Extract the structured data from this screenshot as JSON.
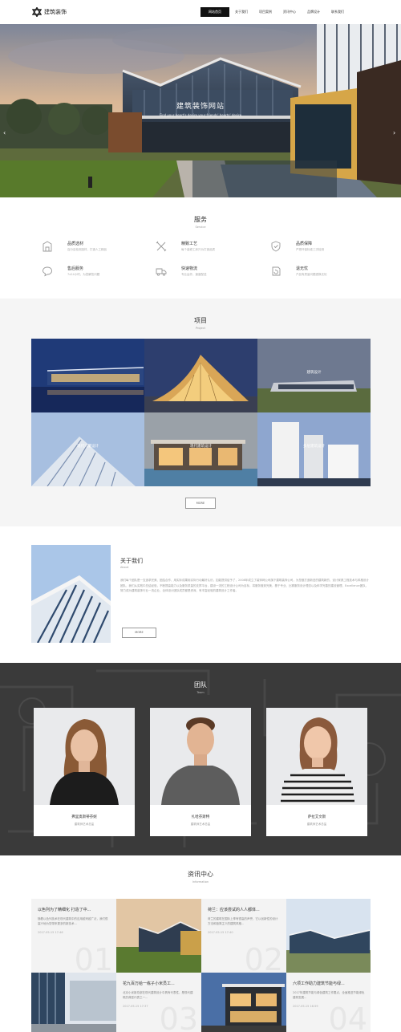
{
  "header": {
    "logo_text": "建筑装饰",
    "nav": [
      "网站首页",
      "关于我们",
      "项目案例",
      "资讯中心",
      "品牌设计",
      "联系我们"
    ],
    "active_index": 0
  },
  "hero": {
    "caption": "建筑装饰网站",
    "sub": "Find your heart's desire,your friends' hearts' desire"
  },
  "service": {
    "title": "服务",
    "title_en": "Service",
    "items": [
      {
        "icon": "building-icon",
        "title": "品质选材",
        "desc": "百分百检测选材，打造人工精品"
      },
      {
        "icon": "tools-icon",
        "title": "精致工艺",
        "desc": "每个装修工序只为打造品质"
      },
      {
        "icon": "shield-icon",
        "title": "品质保障",
        "desc": "严把环保标准三次检测"
      },
      {
        "icon": "chat-icon",
        "title": "售后服务",
        "desc": "7x24小时，为您解答问题"
      },
      {
        "icon": "truck-icon",
        "title": "快速物流",
        "desc": "专业运作，速度配送"
      },
      {
        "icon": "refresh-icon",
        "title": "退无忧",
        "desc": "产品有质量问题退换无忧"
      }
    ]
  },
  "project": {
    "title": "项目",
    "title_en": "Project",
    "labels": [
      "",
      "",
      "建筑设计",
      "现代大厦设计",
      "现代建筑设计",
      "多层建筑设计"
    ],
    "more": "MORE"
  },
  "about": {
    "title": "关于我们",
    "title_en": "About",
    "text": "我们每个团队是一支追求完美、团结合作、用实际成果用实际行动最好认识。如能提供给予了，2008年成立了装饰网公司旗下建筑装饰公司，为您做打造新旧的建筑新的，设计家具工程技术与风格设计团队，我们从实践中总结经验，不断提高能力以及服务质量的支撑平台，建设一流的工程设计公司为目标，将服务做到完美，基于专业、比赛服务设计理念以及科学完善的建设管理，Excellence团队，努力成为建筑装饰行业一流企业，全体设计团队成员都是资深、有丰富经验的建筑设计工作者。",
    "more": "MORE"
  },
  "team": {
    "title": "团队",
    "title_en": "Team",
    "members": [
      {
        "name": "弗里奥斯蒂芬妮",
        "role": "建筑师艺术总监"
      },
      {
        "name": "扎哈芬斯特",
        "role": "建筑师艺术总监"
      },
      {
        "name": "萨拉艾文斯",
        "role": "建筑师艺术总监"
      }
    ]
  },
  "information": {
    "title": "资讯中心",
    "title_en": "Information",
    "news": [
      {
        "title": "以色列为了精细化 打造了中...",
        "desc": "随着以色列技术在现代建筑中的应用越来越广泛，我们很高兴地为您带来更多的新技术...",
        "date": "2017-05-15 17:46",
        "num": "01"
      },
      {
        "title": "荷兰：应该尝试的人人都体...",
        "desc": "荷兰的建筑在国际上享有很高的声誉，它以创新性的设计方法和极简主义的建筑风格...",
        "date": "2017-05-15 17:40",
        "num": "02"
      },
      {
        "title": "花九百万给一栋子小米员工...",
        "desc": "北京小米新总部在现代建筑设计中具有代表性，是现代建筑的典型代表之一...",
        "date": "2017-05-15 17:37",
        "num": "03"
      },
      {
        "title": "六项工作助力建筑节能与绿...",
        "desc": "2017年建筑节能与绿色建筑工作要点，全面推进节能绿色建筑发展...",
        "date": "2017-05-15 16:59",
        "num": "04"
      }
    ]
  },
  "colors": {
    "dark": "#111111",
    "team_bg": "#3a3a3a",
    "project_bg": "#f5f5f5"
  }
}
